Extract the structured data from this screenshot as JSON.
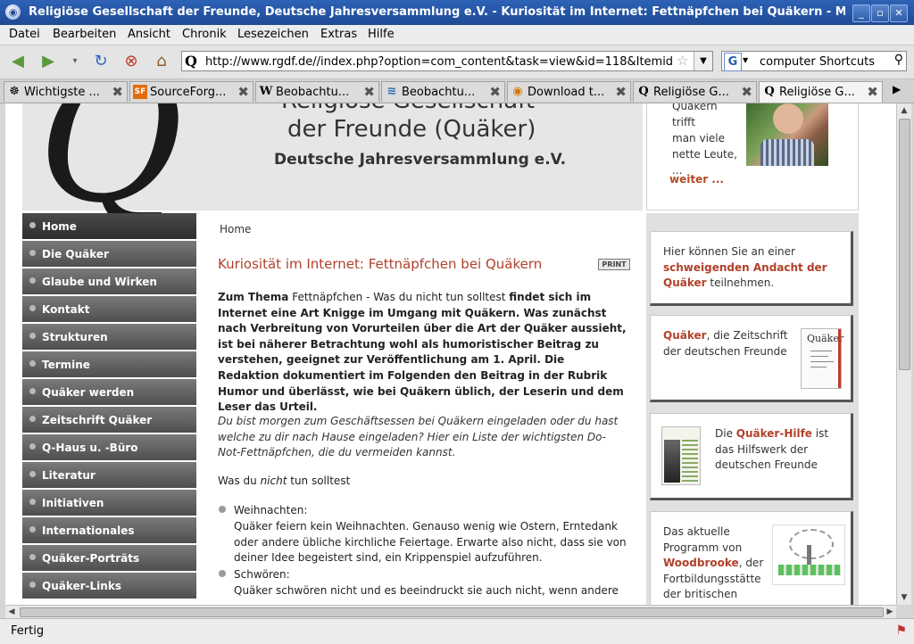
{
  "window": {
    "title": "Religiöse Gesellschaft der Freunde, Deutsche Jahresversammlung e.V. - Kuriosität im Internet: Fettnäpfchen bei Quäkern - Mozilla Firefox",
    "controls": [
      "_",
      "▫",
      "✕"
    ]
  },
  "menu": [
    "Datei",
    "Bearbeiten",
    "Ansicht",
    "Chronik",
    "Lesezeichen",
    "Extras",
    "Hilfe"
  ],
  "navigation": {
    "url": "http://www.rgdf.de//index.php?option=com_content&task=view&id=118&Itemid=",
    "url_favicon": "Q",
    "search_value": "computer Shortcuts",
    "search_engine": "G"
  },
  "tabs": [
    {
      "label": "Wichtigste ...",
      "favicon": "☸",
      "active": false
    },
    {
      "label": "SourceForg...",
      "favicon": "SF",
      "active": false
    },
    {
      "label": "Beobachtu...",
      "favicon": "W",
      "active": false
    },
    {
      "label": "Beobachtu...",
      "favicon": "≋",
      "active": false
    },
    {
      "label": "Download t...",
      "favicon": "◉",
      "active": false
    },
    {
      "label": "Religiöse G...",
      "favicon": "Q",
      "active": false
    },
    {
      "label": "Religiöse G...",
      "favicon": "Q",
      "active": true
    }
  ],
  "header": {
    "org_line1": "Religiöse Gesellschaft",
    "org_line2": "der Freunde (Quäker)",
    "org_line3": "Deutsche Jahresversammlung e.V.",
    "logo_letter": "Q"
  },
  "portrait": {
    "text": "Quäkern trifft\nman viele\nnette Leute,\n...",
    "link": "weiter ..."
  },
  "nav": [
    {
      "label": "Home",
      "active": true
    },
    {
      "label": "Die Quäker"
    },
    {
      "label": "Glaube und Wirken"
    },
    {
      "label": "Kontakt"
    },
    {
      "label": "Strukturen"
    },
    {
      "label": "Termine"
    },
    {
      "label": "Quäker werden"
    },
    {
      "label": "Zeitschrift Quäker"
    },
    {
      "label": "Q-Haus u. -Büro"
    },
    {
      "label": "Literatur"
    },
    {
      "label": "Initiativen"
    },
    {
      "label": "Internationales"
    },
    {
      "label": "Quäker-Porträts"
    },
    {
      "label": "Quäker-Links"
    }
  ],
  "article": {
    "breadcrumb": "Home",
    "title": "Kuriosität im Internet: Fettnäpfchen bei Quäkern",
    "print_label": "PRINT",
    "intro_bold1": "Zum Thema",
    "intro_normal": " Fettnäpfchen - Was du nicht tun solltest ",
    "intro_bold2": "findet sich im Internet eine Art Knigge im Umgang mit Quäkern. Was zunächst nach Verbreitung von Vorurteilen über die Art der Quäker aussieht, ist bei näherer Betrachtung wohl als humoristischer Beitrag zu verstehen, geeignet zur Veröffentlichung am 1. April. Die Redaktion dokumentiert im Folgenden den Beitrag in der Rubrik Humor und überlässt, wie bei Quäkern üblich, der Leserin und dem Leser das Urteil.",
    "italic_par": "Du bist morgen zum Geschäftsessen bei Quäkern eingeladen oder du hast welche zu dir nach Hause eingeladen? Hier ein Liste der wichtigsten Do-Not-Fettnäpfchen, die du vermeiden kannst.",
    "was_pre": "Was du ",
    "was_em": "nicht",
    "was_post": " tun solltest",
    "items": [
      {
        "head": "Weihnachten:",
        "body": "Quäker feiern kein Weihnachten. Genauso wenig wie Ostern, Erntedank oder andere übliche kirchliche Feiertage. Erwarte also nicht, dass sie von deiner Idee begeistert sind, ein Krippenspiel aufzuführen."
      },
      {
        "head": "Schwören:",
        "body": "Quäker schwören nicht und es beeindruckt sie auch nicht, wenn andere"
      }
    ]
  },
  "sidebar": {
    "box1_pre": "Hier können Sie an einer ",
    "box1_link": "schweigenden Andacht der Quäker",
    "box1_post": " teilnehmen.",
    "box2_link": "Quäker",
    "box2_post": ", die Zeitschrift der deutschen Freunde",
    "box2_img_title": "Quäker",
    "box3_pre": "Die ",
    "box3_link": "Quäker-Hilfe",
    "box3_post": " ist das Hilfswerk der deutschen Freunde",
    "box4_pre": "Das aktuelle Programm von ",
    "box4_link": "Woodbrooke",
    "box4_post": ", der Fortbildungsstätte der britischen Quäker"
  },
  "status": {
    "text": "Fertig"
  }
}
